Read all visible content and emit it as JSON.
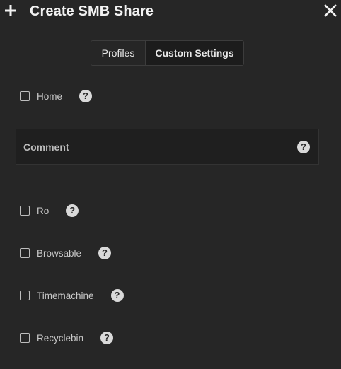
{
  "header": {
    "title": "Create SMB Share",
    "icons": {
      "add": "plus-icon",
      "close": "close-icon"
    }
  },
  "tabs": [
    {
      "label": "Profiles",
      "active": false
    },
    {
      "label": "Custom Settings",
      "active": true
    }
  ],
  "fields": {
    "home": {
      "label": "Home",
      "checked": false
    },
    "comment": {
      "label": "Comment",
      "value": ""
    },
    "ro": {
      "label": "Ro",
      "checked": false
    },
    "browsable": {
      "label": "Browsable",
      "checked": false
    },
    "timemachine": {
      "label": "Timemachine",
      "checked": false
    },
    "recyclebin": {
      "label": "Recyclebin",
      "checked": false
    }
  },
  "help_glyph": "?",
  "colors": {
    "background": "#262626",
    "input_background": "#1f1f1f",
    "active_tab": "#1c1c1c",
    "help_badge": "#d9d9d9"
  }
}
